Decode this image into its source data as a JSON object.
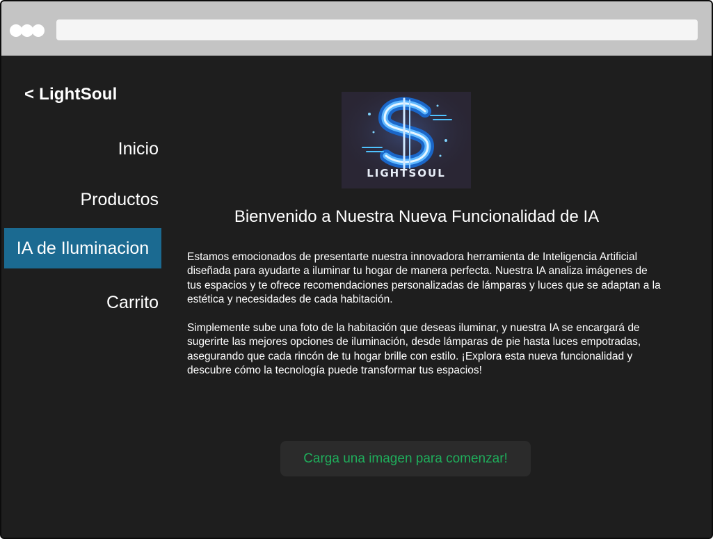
{
  "browser": {
    "url": ""
  },
  "brand": {
    "label": "< LightSoul"
  },
  "nav": {
    "items": [
      {
        "label": "Inicio"
      },
      {
        "label": "Productos"
      },
      {
        "label": "IA de Iluminacion",
        "active": true
      },
      {
        "label": "Carrito"
      }
    ]
  },
  "logo": {
    "text": "LIGHTSOUL"
  },
  "main": {
    "heading": "Bienvenido a Nuestra Nueva Funcionalidad de IA",
    "paragraph1": "Estamos emocionados de presentarte nuestra innovadora herramienta de Inteligencia Artificial diseñada para ayudarte a iluminar tu hogar de manera perfecta. Nuestra IA analiza imágenes de tus espacios y te ofrece recomendaciones personalizadas de lámparas y luces que se adaptan a la estética y necesidades de cada habitación.",
    "paragraph2": "Simplemente sube una foto de la habitación que deseas iluminar, y nuestra IA se encargará de sugerirte las mejores opciones de iluminación, desde lámparas de pie hasta luces empotradas, asegurando que cada rincón de tu hogar brille con estilo. ¡Explora esta nueva funcionalidad y descubre cómo la tecnología puede transformar tus espacios!",
    "cta_label": "Carga una imagen para comenzar!"
  },
  "colors": {
    "background": "#1e1e1e",
    "nav_active": "#1b6a91",
    "cta_text": "#1fad5b",
    "cta_background": "#2b2b2b",
    "titlebar": "#c4c4c4"
  }
}
